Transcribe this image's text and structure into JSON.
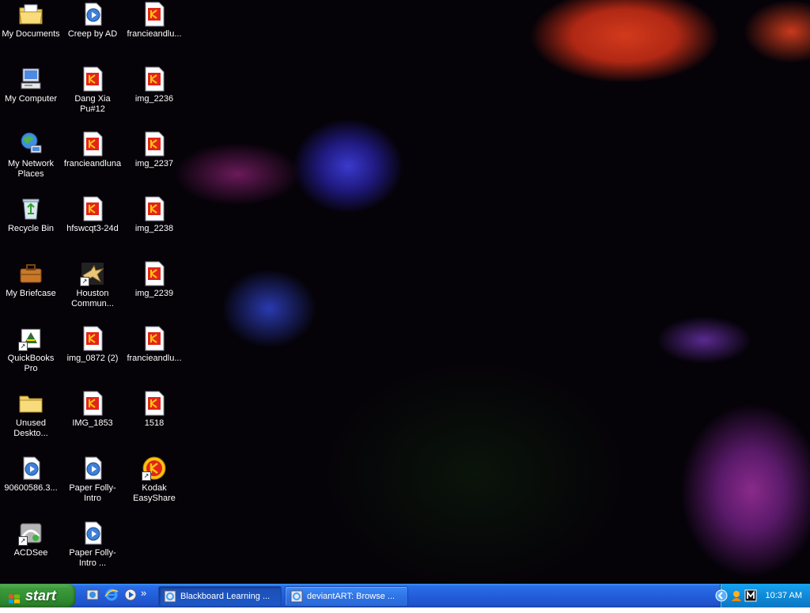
{
  "desktop": {
    "icons": [
      {
        "label": "My Documents",
        "icon": "folder-documents-icon"
      },
      {
        "label": "Creep by AD",
        "icon": "media-file-icon"
      },
      {
        "label": "francieandlu...",
        "icon": "kodak-image-icon"
      },
      {
        "label": "My Computer",
        "icon": "computer-icon"
      },
      {
        "label": "Dang Xia Pu#12",
        "icon": "kodak-image-icon"
      },
      {
        "label": "img_2236",
        "icon": "kodak-image-icon"
      },
      {
        "label": "My Network Places",
        "icon": "network-places-icon"
      },
      {
        "label": "francieandluna",
        "icon": "kodak-image-icon"
      },
      {
        "label": "img_2237",
        "icon": "kodak-image-icon"
      },
      {
        "label": "Recycle Bin",
        "icon": "recycle-bin-icon"
      },
      {
        "label": "hfswcqt3-24d",
        "icon": "kodak-image-icon"
      },
      {
        "label": "img_2238",
        "icon": "kodak-image-icon"
      },
      {
        "label": "My Briefcase",
        "icon": "briefcase-icon"
      },
      {
        "label": "Houston Commun...",
        "icon": "eagle-shortcut-icon"
      },
      {
        "label": "img_2239",
        "icon": "kodak-image-icon"
      },
      {
        "label": "QuickBooks Pro",
        "icon": "quickbooks-icon"
      },
      {
        "label": "img_0872 (2)",
        "icon": "kodak-image-icon"
      },
      {
        "label": "francieandlu...",
        "icon": "kodak-image-icon"
      },
      {
        "label": "Unused Deskto...",
        "icon": "folder-icon"
      },
      {
        "label": "IMG_1853",
        "icon": "kodak-image-icon"
      },
      {
        "label": "1518",
        "icon": "kodak-image-icon"
      },
      {
        "label": "90600586.3...",
        "icon": "media-file-icon"
      },
      {
        "label": "Paper Folly-Intro",
        "icon": "media-file-icon"
      },
      {
        "label": "Kodak EasyShare",
        "icon": "kodak-easyshare-icon"
      },
      {
        "label": "ACDSee",
        "icon": "acdsee-icon"
      },
      {
        "label": "Paper Folly-Intro ...",
        "icon": "media-file-icon"
      }
    ]
  },
  "taskbar": {
    "start_label": "start",
    "quicklaunch": [
      "windows-explorer-icon",
      "internet-explorer-icon",
      "media-player-icon"
    ],
    "overflow_label": "»",
    "tasks": [
      {
        "label": "Blackboard Learning ...",
        "icon": "internet-explorer-icon",
        "active": true
      },
      {
        "label": "deviantART: Browse ...",
        "icon": "internet-explorer-icon",
        "active": false
      }
    ],
    "tray": {
      "icons": [
        "tray-expand-icon",
        "messenger-icon",
        "m-app-icon"
      ],
      "clock": "10:37 AM"
    }
  },
  "colors": {
    "taskbar_blue": "#245edb",
    "start_green": "#3c9a3c",
    "tray_blue": "#0f8ad8",
    "kodak_red": "#e1251b",
    "kodak_yellow": "#ffc20e"
  }
}
